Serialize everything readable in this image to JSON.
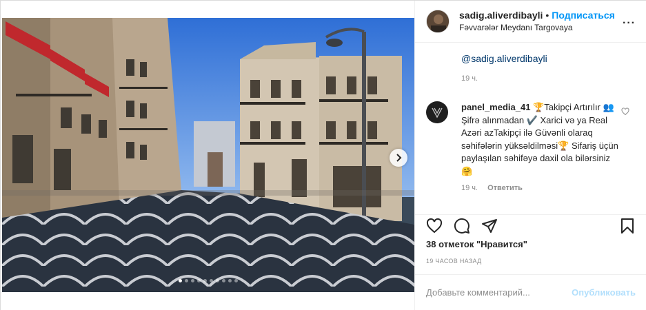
{
  "header": {
    "username": "sadig.aliverdibayli",
    "separator": "•",
    "follow_label": "Подписаться",
    "location": "Fəvvarələr Meydanı Targovaya",
    "more_icon": "more-horizontal-icon"
  },
  "comments": [
    {
      "text": "@sadig.aliverdibayli",
      "time": "19 ч."
    },
    {
      "username": "panel_media_41",
      "text": "🏆Takipçi Artırılır 👥 Şifrə alınmadan ✔️ Xarici və ya Real Azəri azTakipçi ilə Güvənli olaraq səhifələrin yüksəldilməsi🏆 Sifariş üçün paylaşılan səhifəyə daxil ola bilərsiniz🤗",
      "time": "19 ч.",
      "reply_label": "Ответить"
    }
  ],
  "likes": "38 отметок \"Нравится\"",
  "time_ago": "19 ЧАСОВ НАЗАД",
  "add_comment": {
    "placeholder": "Добавьте комментарий...",
    "publish_label": "Опубликовать"
  },
  "carousel": {
    "total_slides": 10,
    "active_slide": 1
  },
  "colors": {
    "accent": "#0095f6",
    "publish_disabled": "#b2dffc",
    "muted": "#8e8e8e"
  }
}
